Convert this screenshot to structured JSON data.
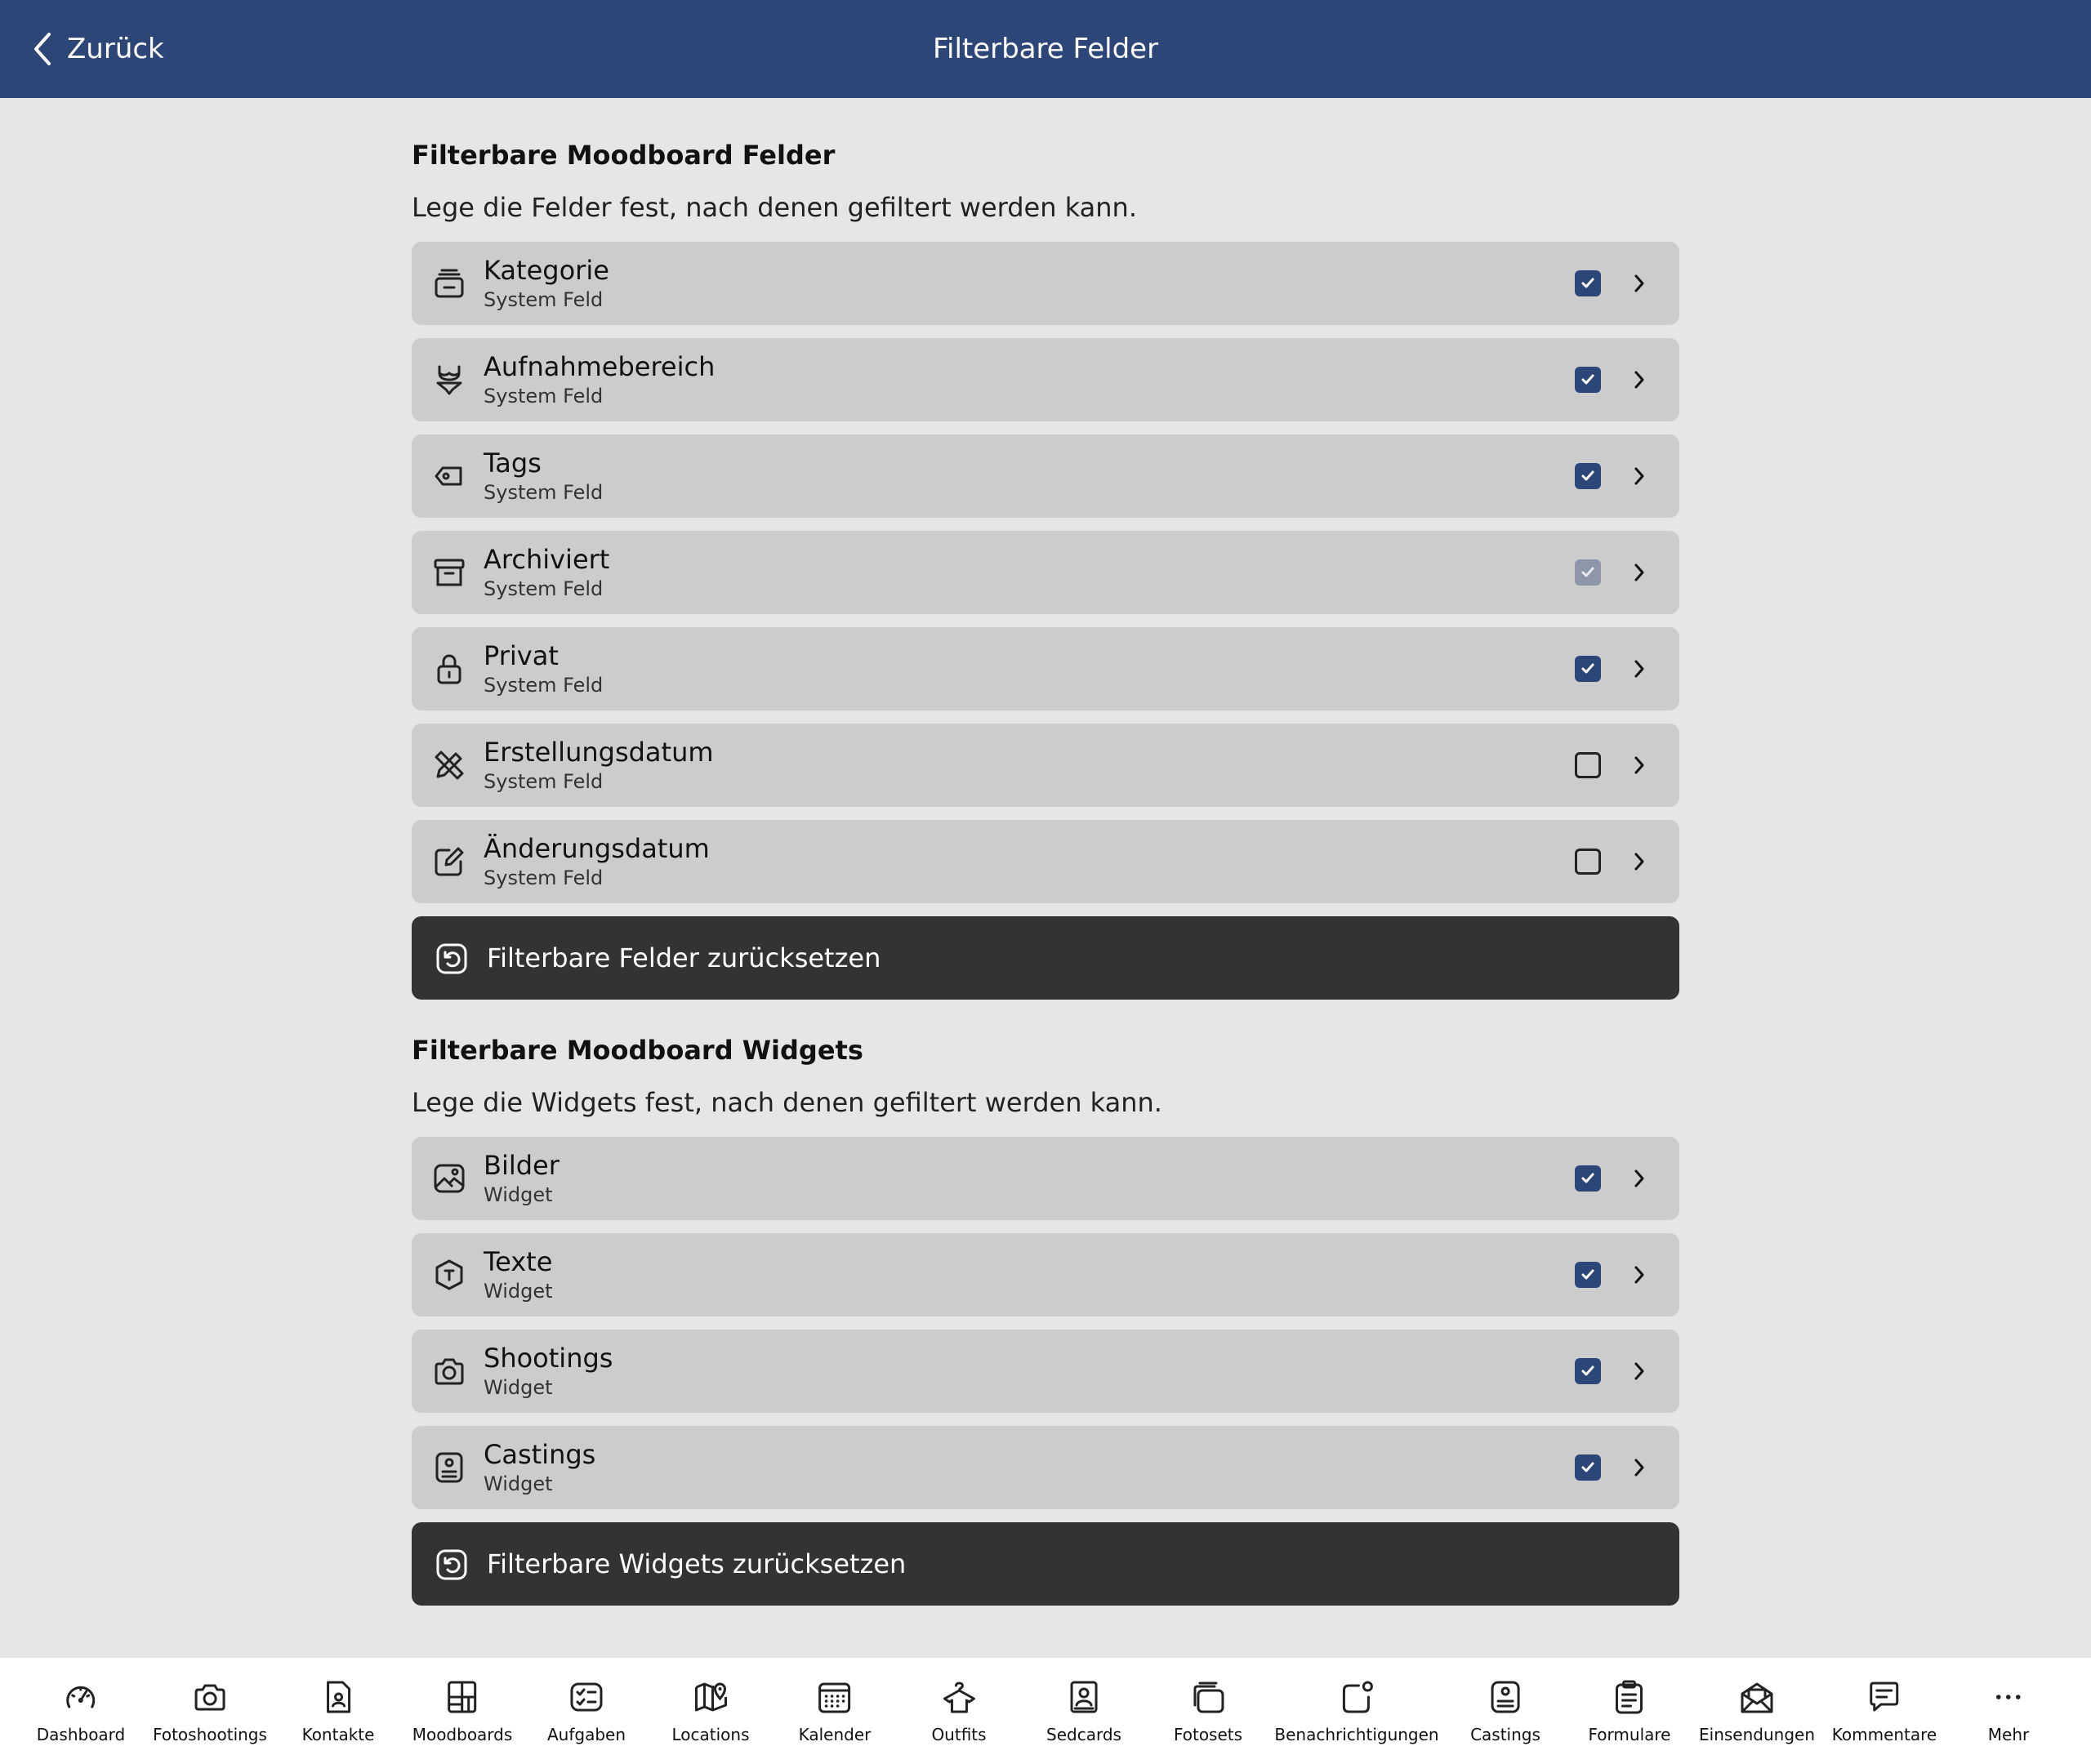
{
  "header": {
    "back_label": "Zurück",
    "title": "Filterbare Felder",
    "background": "#2c4678"
  },
  "fields_section": {
    "title": "Filterbare Moodboard Felder",
    "description": "Lege die Felder fest, nach denen gefiltert werden kann.",
    "items": [
      {
        "name": "Kategorie",
        "subtitle": "System Feld",
        "icon": "category-stack-icon",
        "checked": true,
        "enabled": true
      },
      {
        "name": "Aufnahmebereich",
        "subtitle": "System Feld",
        "icon": "bikini-icon",
        "checked": true,
        "enabled": true
      },
      {
        "name": "Tags",
        "subtitle": "System Feld",
        "icon": "tag-icon",
        "checked": true,
        "enabled": true
      },
      {
        "name": "Archiviert",
        "subtitle": "System Feld",
        "icon": "archive-box-icon",
        "checked": true,
        "enabled": false
      },
      {
        "name": "Privat",
        "subtitle": "System Feld",
        "icon": "lock-icon",
        "checked": true,
        "enabled": true
      },
      {
        "name": "Erstellungsdatum",
        "subtitle": "System Feld",
        "icon": "pencil-ruler-icon",
        "checked": false,
        "enabled": true
      },
      {
        "name": "Änderungsdatum",
        "subtitle": "System Feld",
        "icon": "edit-square-icon",
        "checked": false,
        "enabled": true
      }
    ],
    "reset_label": "Filterbare Felder zurücksetzen"
  },
  "widgets_section": {
    "title": "Filterbare Moodboard Widgets",
    "description": "Lege die Widgets fest, nach denen gefiltert werden kann.",
    "items": [
      {
        "name": "Bilder",
        "subtitle": "Widget",
        "icon": "image-icon",
        "checked": true,
        "enabled": true
      },
      {
        "name": "Texte",
        "subtitle": "Widget",
        "icon": "text-hexagon-icon",
        "checked": true,
        "enabled": true
      },
      {
        "name": "Shootings",
        "subtitle": "Widget",
        "icon": "camera-icon",
        "checked": true,
        "enabled": true
      },
      {
        "name": "Castings",
        "subtitle": "Widget",
        "icon": "casting-card-icon",
        "checked": true,
        "enabled": true
      }
    ],
    "reset_label": "Filterbare Widgets zurücksetzen"
  },
  "tabbar": {
    "items": [
      {
        "label": "Dashboard",
        "icon": "speedometer-icon"
      },
      {
        "label": "Fotoshootings",
        "icon": "camera-icon"
      },
      {
        "label": "Kontakte",
        "icon": "contact-file-icon"
      },
      {
        "label": "Moodboards",
        "icon": "moodboard-grid-icon"
      },
      {
        "label": "Aufgaben",
        "icon": "checklist-icon"
      },
      {
        "label": "Locations",
        "icon": "map-pin-icon"
      },
      {
        "label": "Kalender",
        "icon": "calendar-icon"
      },
      {
        "label": "Outfits",
        "icon": "shirt-hanger-icon"
      },
      {
        "label": "Sedcards",
        "icon": "sedcard-icon"
      },
      {
        "label": "Fotosets",
        "icon": "photo-stack-icon"
      },
      {
        "label": "Benachrichtigungen",
        "icon": "notification-icon"
      },
      {
        "label": "Castings",
        "icon": "casting-card-icon"
      },
      {
        "label": "Formulare",
        "icon": "clipboard-form-icon"
      },
      {
        "label": "Einsendungen",
        "icon": "mail-open-icon"
      },
      {
        "label": "Kommentare",
        "icon": "comment-icon"
      },
      {
        "label": "Mehr",
        "icon": "more-dots-icon"
      }
    ]
  }
}
